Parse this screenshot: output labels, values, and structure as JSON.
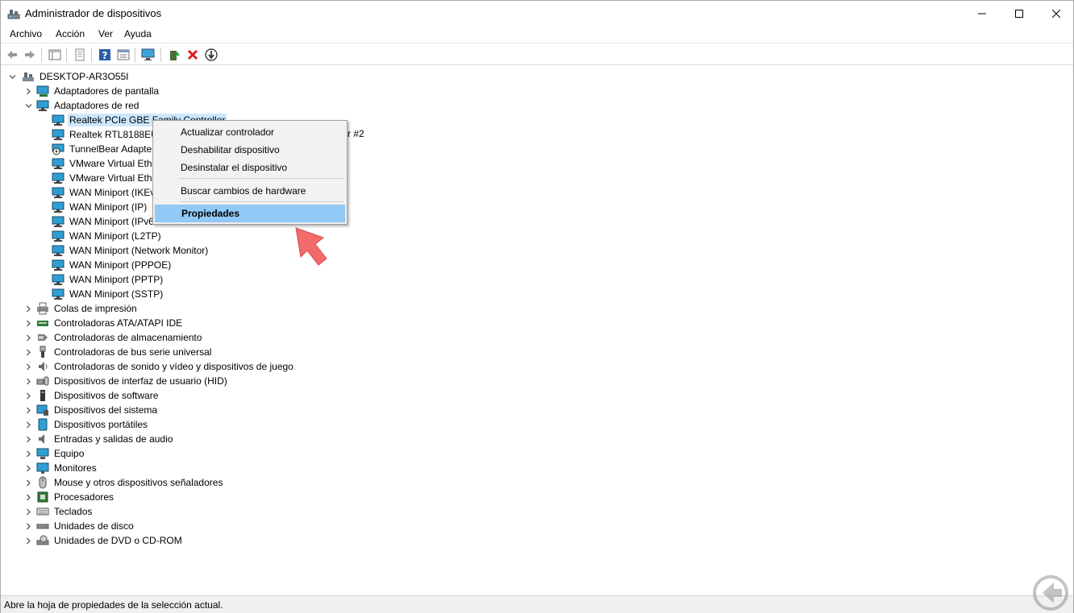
{
  "window": {
    "title": "Administrador de dispositivos",
    "controls": {
      "minimize": "—",
      "maximize": "☐",
      "close": "✕"
    }
  },
  "menu": [
    "Archivo",
    "Acción",
    "Ver",
    "Ayuda"
  ],
  "toolbar": {
    "buttons": [
      "back-icon",
      "forward-icon",
      "show-hide-tree-icon",
      "properties-icon",
      "help-icon",
      "view-icon",
      "monitor-icon",
      "update-driver-icon",
      "uninstall-icon",
      "download-icon"
    ]
  },
  "tree": {
    "root": "DESKTOP-AR3O55I",
    "adapters_display": "Adaptadores de pantalla",
    "adapters_net": "Adaptadores de red",
    "net_children": [
      "Realtek PCIe GBE Family Controller",
      "Realtek RTL8188EU W",
      "TunnelBear Adapter",
      "VMware Virtual Ethe",
      "VMware Virtual Ethe",
      "WAN Miniport (IKEv",
      "WAN Miniport (IP)",
      "WAN Miniport (IPv6",
      "WAN Miniport (L2TP)",
      "WAN Miniport (Network Monitor)",
      "WAN Miniport (PPPOE)",
      "WAN Miniport (PPTP)",
      "WAN Miniport (SSTP)"
    ],
    "partial_suffix": "r #2",
    "categories": [
      "Colas de impresión",
      "Controladoras ATA/ATAPI IDE",
      "Controladoras de almacenamiento",
      "Controladoras de bus serie universal",
      "Controladoras de sonido y vídeo y dispositivos de juego",
      "Dispositivos de interfaz de usuario (HID)",
      "Dispositivos de software",
      "Dispositivos del sistema",
      "Dispositivos portátiles",
      "Entradas y salidas de audio",
      "Equipo",
      "Monitores",
      "Mouse y otros dispositivos señaladores",
      "Procesadores",
      "Teclados",
      "Unidades de disco",
      "Unidades de DVD o CD-ROM"
    ]
  },
  "context_menu": {
    "items": [
      "Actualizar controlador",
      "Deshabilitar dispositivo",
      "Desinstalar el dispositivo",
      "Buscar cambios de hardware",
      "Propiedades"
    ],
    "highlighted": "Propiedades"
  },
  "status": "Abre la hoja de propiedades de la selección actual.",
  "colors": {
    "selection": "#cce8ff",
    "menu_highlight": "#91c9f7",
    "annotation_arrow": "#f26b6b"
  }
}
